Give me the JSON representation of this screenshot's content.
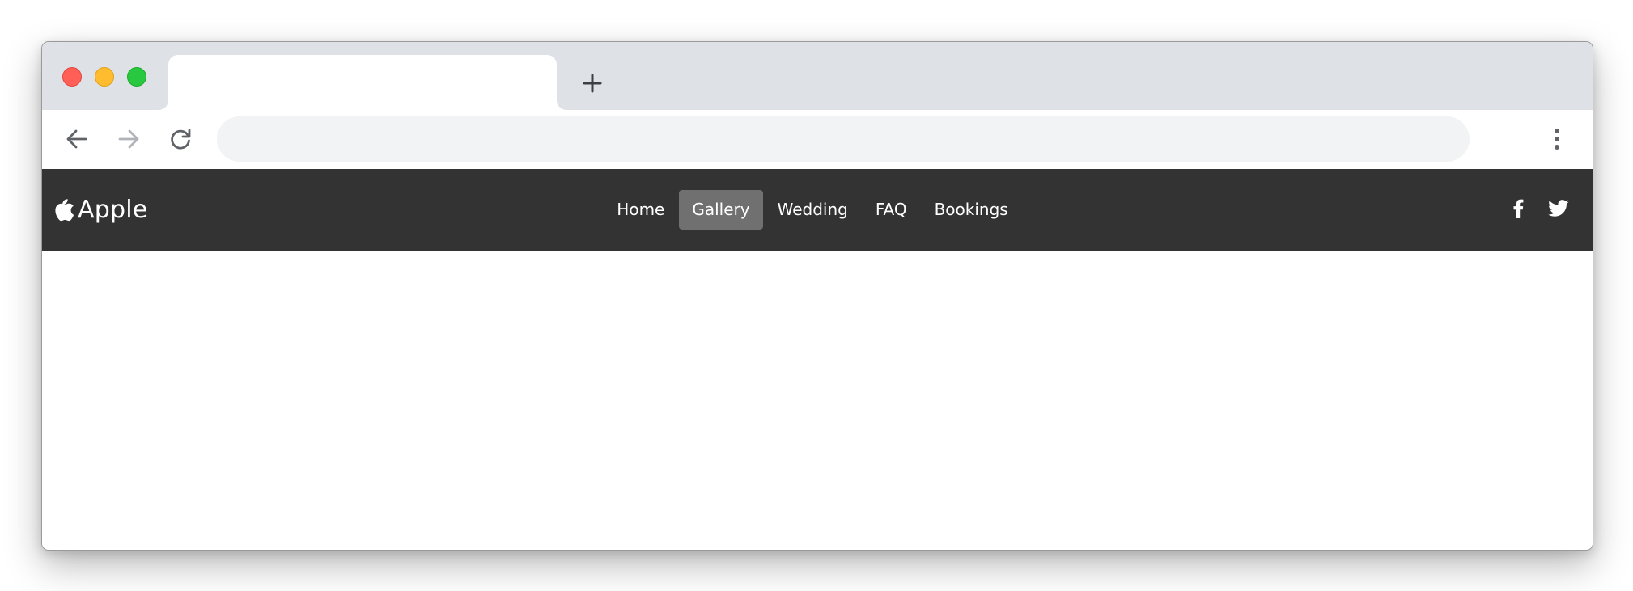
{
  "browser": {
    "tab_title": "",
    "address": "",
    "icons": {
      "close": "close-icon",
      "minimize": "minimize-icon",
      "maximize": "maximize-icon",
      "new_tab": "plus-icon",
      "back": "arrow-left-icon",
      "forward": "arrow-right-icon",
      "reload": "reload-icon",
      "menu": "more-vertical-icon"
    }
  },
  "site": {
    "brand": {
      "icon": "apple-logo-icon",
      "name": "Apple"
    },
    "nav": [
      {
        "label": "Home",
        "active": false
      },
      {
        "label": "Gallery",
        "active": true
      },
      {
        "label": "Wedding",
        "active": false
      },
      {
        "label": "FAQ",
        "active": false
      },
      {
        "label": "Bookings",
        "active": false
      }
    ],
    "social": [
      "facebook-icon",
      "twitter-icon"
    ]
  },
  "colors": {
    "navbar_bg": "#333333",
    "nav_active_bg": "#707070",
    "titlebar_bg": "#dee1e6",
    "omnibox_bg": "#f1f3f4",
    "traffic_red": "#ff5f57",
    "traffic_yellow": "#febc2e",
    "traffic_green": "#28c840"
  }
}
